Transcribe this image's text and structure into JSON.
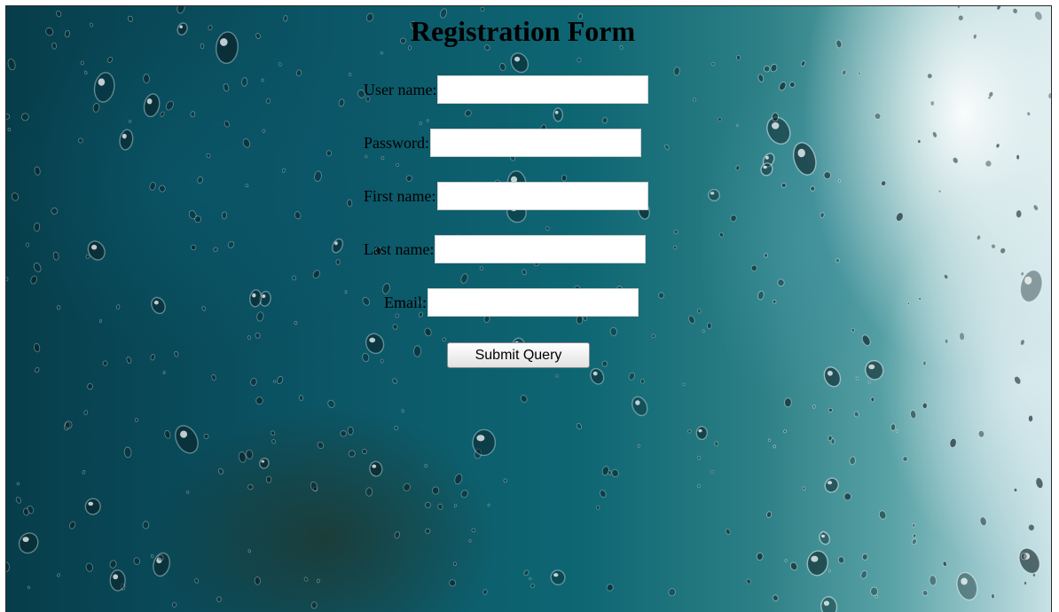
{
  "form": {
    "title": "Registration Form",
    "fields": [
      {
        "label": "User name:",
        "value": ""
      },
      {
        "label": "Password:",
        "value": ""
      },
      {
        "label": "First name:",
        "value": ""
      },
      {
        "label": "Last name:",
        "value": ""
      },
      {
        "label": "Email:",
        "value": ""
      }
    ],
    "submit_label": "Submit Query"
  },
  "colors": {
    "background_dark": "#073d4a",
    "background_light": "#c9e2e6",
    "text": "#000000"
  }
}
